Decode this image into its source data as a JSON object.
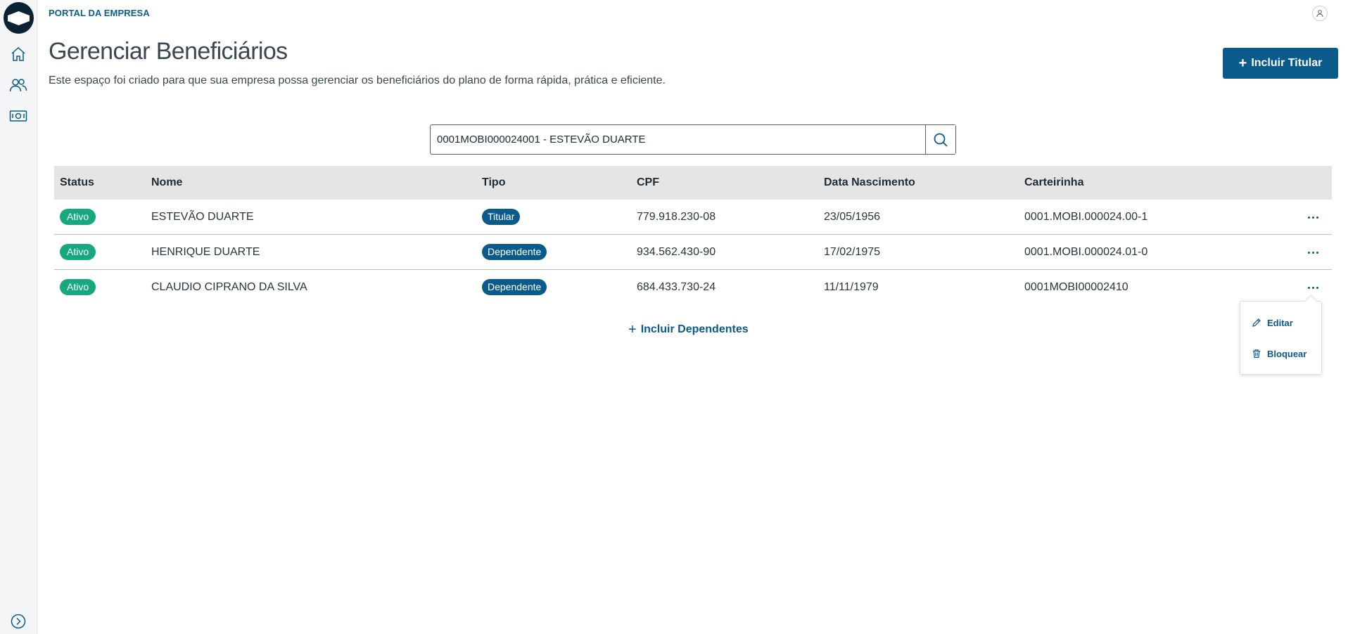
{
  "header": {
    "portal_label": "PORTAL DA EMPRESA",
    "page_title": "Gerenciar Beneficiários",
    "page_description": "Este espaço foi criado para que sua empresa possa gerenciar os beneficiários do plano de forma rápida, prática e eficiente.",
    "add_titular_label": "Incluir Titular"
  },
  "sidebar": {
    "items": [
      {
        "icon": "home-icon"
      },
      {
        "icon": "users-icon"
      },
      {
        "icon": "money-icon"
      }
    ],
    "expand_icon": "chevron-right-circle-icon"
  },
  "search": {
    "value": "0001MOBI000024001 - ESTEVÃO DUARTE",
    "icon": "search-icon"
  },
  "table": {
    "columns": [
      "Status",
      "Nome",
      "Tipo",
      "CPF",
      "Data Nascimento",
      "Carteirinha"
    ],
    "rows": [
      {
        "status": "Ativo",
        "nome": "ESTEVÃO DUARTE",
        "tipo": "Titular",
        "cpf": "779.918.230-08",
        "data_nascimento": "23/05/1956",
        "carteirinha": "0001.MOBI.000024.00-1"
      },
      {
        "status": "Ativo",
        "nome": "HENRIQUE DUARTE",
        "tipo": "Dependente",
        "cpf": "934.562.430-90",
        "data_nascimento": "17/02/1975",
        "carteirinha": "0001.MOBI.000024.01-0"
      },
      {
        "status": "Ativo",
        "nome": "CLAUDIO CIPRANO DA SILVA",
        "tipo": "Dependente",
        "cpf": "684.433.730-24",
        "data_nascimento": "11/11/1979",
        "carteirinha": "0001MOBI00002410"
      }
    ]
  },
  "add_dependents_label": "Incluir Dependentes",
  "row_menu": {
    "edit_label": "Editar",
    "block_label": "Bloquear"
  },
  "colors": {
    "primary": "#0b5a8c",
    "status_active": "#17a87f",
    "header_bg": "#e5e5e5"
  }
}
